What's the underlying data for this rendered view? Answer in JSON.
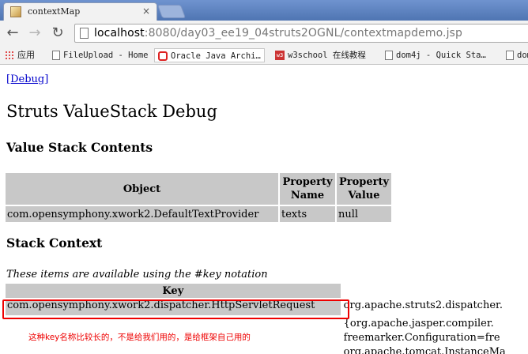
{
  "browser": {
    "tab_title": "contextMap",
    "tab_close": "×",
    "url_host": "localhost",
    "url_rest": ":8080/day03_ee19_04struts2OGNL/contextmapdemo.jsp",
    "back_glyph": "←",
    "forward_glyph": "→",
    "reload_glyph": "↻"
  },
  "bookmarks": {
    "apps": "应用",
    "items": [
      "FileUpload - Home",
      "Oracle Java Archi…",
      "w3school 在线教程",
      "dom4j - Quick Sta…",
      "dom"
    ],
    "w3_badge": "w3"
  },
  "page": {
    "debug_link": "[Debug]",
    "title": "Struts ValueStack Debug",
    "value_stack_heading": "Value Stack Contents",
    "value_stack_table": {
      "headers": [
        "Object",
        "Property Name",
        "Property Value"
      ],
      "header_name_line1": "Property",
      "header_name_line2": "Name",
      "header_value_line1": "Property",
      "header_value_line2": "Value",
      "rows": [
        [
          "com.opensymphony.xwork2.DefaultTextProvider",
          "texts",
          "null"
        ]
      ]
    },
    "stack_context_heading": "Stack Context",
    "stack_context_note": "These items are available using the #key notation",
    "stack_context_table": {
      "key_header": "Key",
      "row1_key": "com.opensymphony.xwork2.dispatcher.HttpServletRequest",
      "row1_value": "org.apache.struts2.dispatcher.",
      "row2_value_line1": "{org.apache.jasper.compiler.",
      "row2_value_line2": "freemarker.Configuration=fre",
      "row2_value_line3": "org.apache.tomcat.InstanceMa"
    },
    "annotation": "这种key名称比较长的，不是给我们用的，是给框架自己用的"
  },
  "colors": {
    "highlight": "#e00000",
    "table_cell": "#c8c8c8",
    "link": "#0000cc"
  }
}
